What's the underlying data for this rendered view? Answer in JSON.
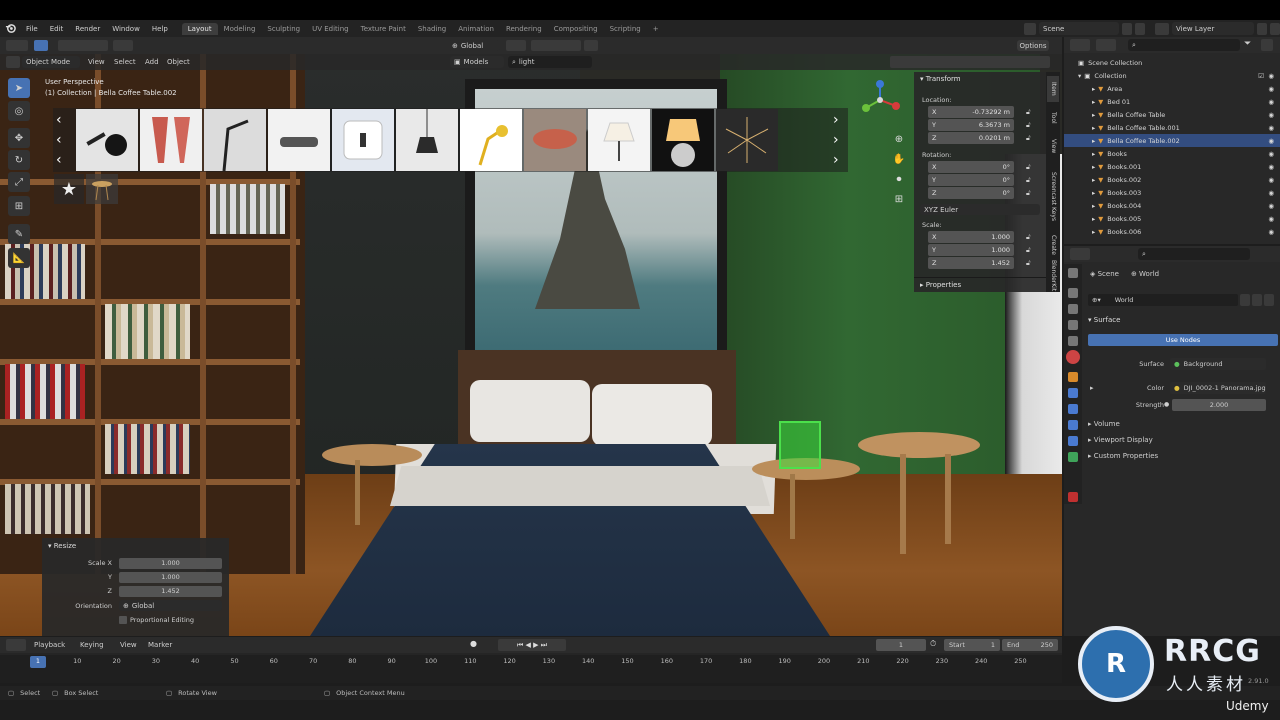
{
  "menubar": {
    "items": [
      "File",
      "Edit",
      "Render",
      "Window",
      "Help"
    ],
    "workspace_tabs": [
      "Layout",
      "Modeling",
      "Sculpting",
      "UV Editing",
      "Texture Paint",
      "Shading",
      "Animation",
      "Rendering",
      "Compositing",
      "Scripting"
    ],
    "active_tab": "Layout",
    "add_tab": "+",
    "scene_label": "Scene",
    "view_layer_label": "View Layer"
  },
  "header": {
    "transform_orientation": "Global",
    "mode": "Object Mode",
    "menus": [
      "View",
      "Select",
      "Add",
      "Object"
    ],
    "search_category": "Models",
    "search_query": "light",
    "options_label": "Options"
  },
  "viewport": {
    "view_name": "User Perspective",
    "collection_info": "(1) Collection | Bella Coffee Table.002"
  },
  "asset_browser": {
    "items": [
      "wall-lamp",
      "sconce-pair",
      "floor-lamp",
      "ceiling-light",
      "wall-switch",
      "pendant-lamp",
      "desk-lamp",
      "industrial-lamp",
      "table-lamp",
      "table-lamp-lit",
      "chandelier"
    ]
  },
  "npanel": {
    "transform_title": "Transform",
    "location_label": "Location:",
    "location": {
      "x": "-0.73292 m",
      "y": "6.3673 m",
      "z": "0.0201 m"
    },
    "rotation_label": "Rotation:",
    "rotation": {
      "x": "0°",
      "y": "0°",
      "z": "0°"
    },
    "rotation_mode": "XYZ Euler",
    "scale_label": "Scale:",
    "scale": {
      "x": "1.000",
      "y": "1.000",
      "z": "1.452"
    },
    "axis": {
      "x": "X",
      "y": "Y",
      "z": "Z"
    },
    "properties_title": "Properties",
    "side_tabs": [
      "Item",
      "Tool",
      "View",
      "Screencast Keys",
      "Create",
      "BlenderKit"
    ]
  },
  "resize_panel": {
    "title": "Resize",
    "scale_x_label": "Scale X",
    "y_label": "Y",
    "z_label": "Z",
    "scale_x": "1.000",
    "scale_y": "1.000",
    "scale_z": "1.452",
    "orientation_label": "Orientation",
    "orientation_value": "Global",
    "proportional_label": "Proportional Editing"
  },
  "outliner": {
    "scene_collection": "Scene Collection",
    "rows": [
      {
        "label": "Collection",
        "level": 1,
        "selected": false
      },
      {
        "label": "Area",
        "level": 2,
        "selected": false
      },
      {
        "label": "Bed 01",
        "level": 2,
        "selected": false
      },
      {
        "label": "Bella Coffee Table",
        "level": 2,
        "selected": false
      },
      {
        "label": "Bella Coffee Table.001",
        "level": 2,
        "selected": false
      },
      {
        "label": "Bella Coffee Table.002",
        "level": 2,
        "selected": true
      },
      {
        "label": "Books",
        "level": 2,
        "selected": false
      },
      {
        "label": "Books.001",
        "level": 2,
        "selected": false
      },
      {
        "label": "Books.002",
        "level": 2,
        "selected": false
      },
      {
        "label": "Books.003",
        "level": 2,
        "selected": false
      },
      {
        "label": "Books.004",
        "level": 2,
        "selected": false
      },
      {
        "label": "Books.005",
        "level": 2,
        "selected": false
      },
      {
        "label": "Books.006",
        "level": 2,
        "selected": false
      }
    ]
  },
  "properties": {
    "breadcrumb_scene": "Scene",
    "breadcrumb_world": "World",
    "world_name": "World",
    "surface_title": "Surface",
    "use_nodes": "Use Nodes",
    "surface_label": "Surface",
    "surface_value": "Background",
    "color_label": "Color",
    "color_value": "DJI_0002-1 Panorama.jpg",
    "strength_label": "Strength",
    "strength_value": "2.000",
    "volume": "Volume",
    "viewport_display": "Viewport Display",
    "custom_properties": "Custom Properties"
  },
  "timeline": {
    "menus": [
      "Playback",
      "Keying",
      "View",
      "Marker"
    ],
    "current_frame": "1",
    "start_label": "Start",
    "start": "1",
    "end_label": "End",
    "end": "250",
    "ticks": [
      "1",
      "10",
      "20",
      "30",
      "40",
      "50",
      "60",
      "70",
      "80",
      "90",
      "100",
      "110",
      "120",
      "130",
      "140",
      "150",
      "160",
      "170",
      "180",
      "190",
      "200",
      "210",
      "220",
      "230",
      "240",
      "250"
    ]
  },
  "statusbar": {
    "select": "Select",
    "box_select": "Box Select",
    "rotate_view": "Rotate View",
    "context_menu": "Object Context Menu",
    "version": "2.91.0"
  },
  "watermark": {
    "brand": "RRCG",
    "subtitle": "人人素材",
    "udemy": "Udemy"
  },
  "colors": {
    "accent": "#4772b3",
    "selected_row": "#334d80",
    "wall_green": "#2f5a2e"
  }
}
